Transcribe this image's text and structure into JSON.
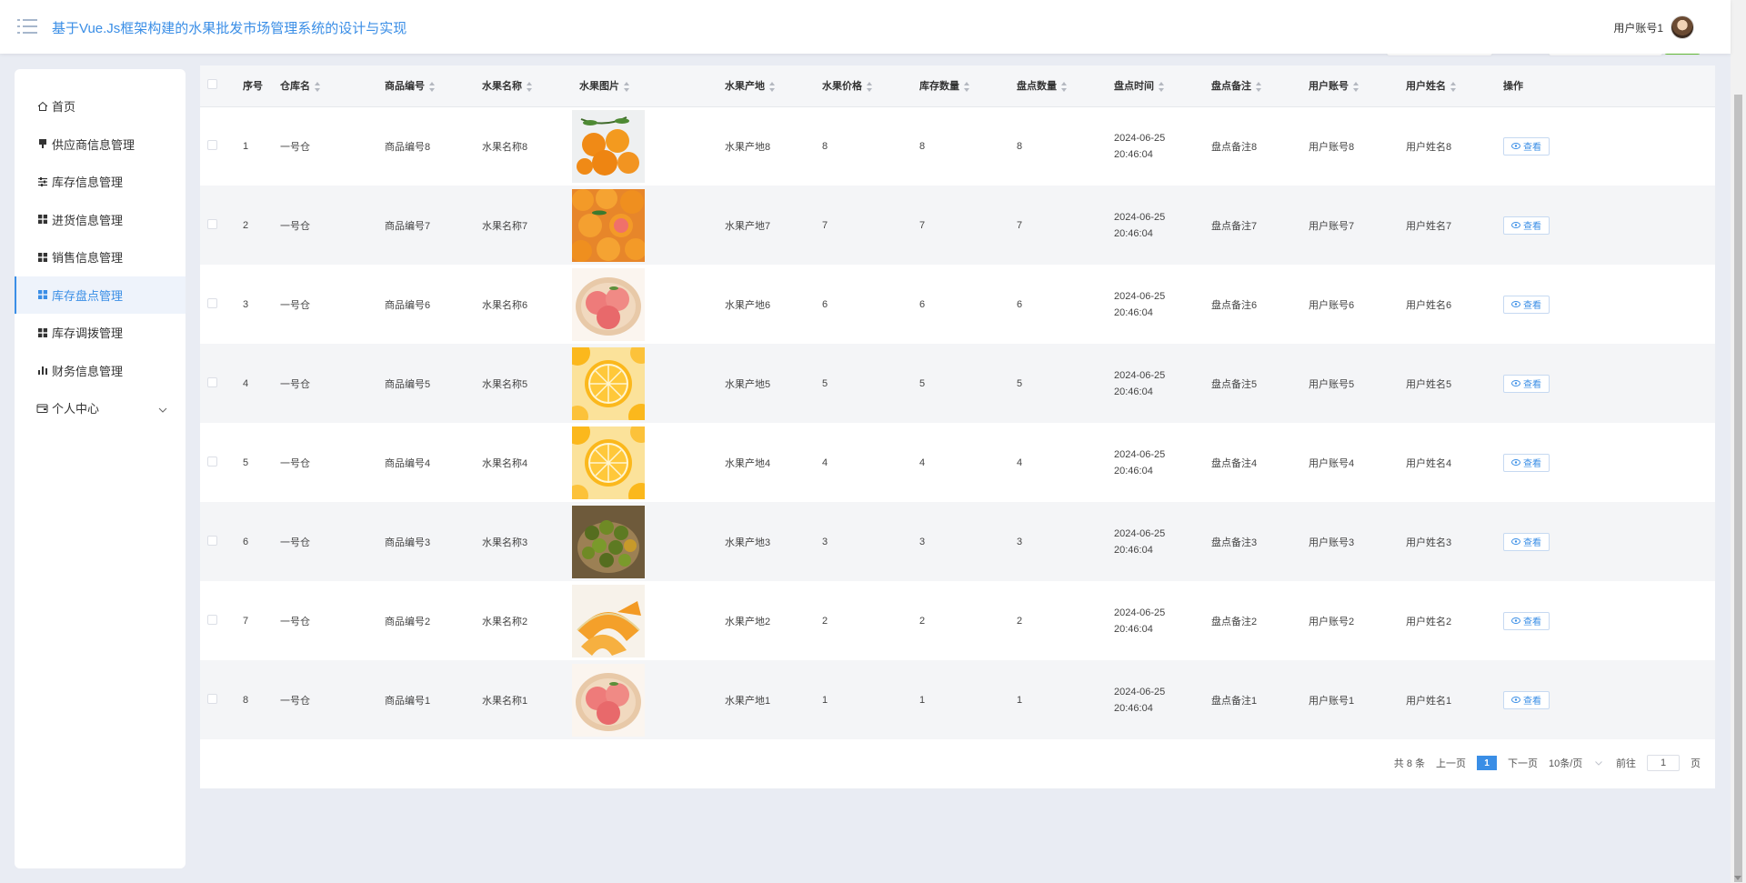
{
  "header": {
    "title": "基于Vue.Js框架构建的水果批发市场管理系统的设计与实现",
    "user_name": "用户账号1"
  },
  "sidebar": {
    "items": [
      {
        "label": "首页",
        "icon": "home-icon",
        "active": false
      },
      {
        "label": "供应商信息管理",
        "icon": "plug-icon",
        "active": false
      },
      {
        "label": "库存信息管理",
        "icon": "sliders-icon",
        "active": false
      },
      {
        "label": "进货信息管理",
        "icon": "grid-icon",
        "active": false
      },
      {
        "label": "销售信息管理",
        "icon": "grid-icon",
        "active": false
      },
      {
        "label": "库存盘点管理",
        "icon": "grid-icon",
        "active": true
      },
      {
        "label": "库存调拨管理",
        "icon": "grid-icon",
        "active": false
      },
      {
        "label": "财务信息管理",
        "icon": "bar-chart-icon",
        "active": false
      },
      {
        "label": "个人中心",
        "icon": "wallet-icon",
        "active": false,
        "expandable": true
      }
    ]
  },
  "table": {
    "columns": [
      "序号",
      "仓库名",
      "商品编号",
      "水果名称",
      "水果图片",
      "水果产地",
      "水果价格",
      "库存数量",
      "盘点数量",
      "盘点时间",
      "盘点备注",
      "用户账号",
      "用户姓名",
      "操作"
    ],
    "rows": [
      {
        "index": "1",
        "warehouse": "一号仓",
        "code": "商品编号8",
        "name": "水果名称8",
        "image": "tangerines-branch",
        "origin": "水果产地8",
        "price": "8",
        "stock": "8",
        "counted": "8",
        "time": "2024-06-25 20:46:04",
        "remark": "盘点备注8",
        "account": "用户账号8",
        "username": "用户姓名8",
        "action": "查看"
      },
      {
        "index": "2",
        "warehouse": "一号仓",
        "code": "商品编号7",
        "name": "水果名称7",
        "image": "tangerines-pile",
        "origin": "水果产地7",
        "price": "7",
        "stock": "7",
        "counted": "7",
        "time": "2024-06-25 20:46:04",
        "remark": "盘点备注7",
        "account": "用户账号7",
        "username": "用户姓名7",
        "action": "查看"
      },
      {
        "index": "3",
        "warehouse": "一号仓",
        "code": "商品编号6",
        "name": "水果名称6",
        "image": "peaches-plate",
        "origin": "水果产地6",
        "price": "6",
        "stock": "6",
        "counted": "6",
        "time": "2024-06-25 20:46:04",
        "remark": "盘点备注6",
        "account": "用户账号6",
        "username": "用户姓名6",
        "action": "查看"
      },
      {
        "index": "4",
        "warehouse": "一号仓",
        "code": "商品编号5",
        "name": "水果名称5",
        "image": "lemon-slices",
        "origin": "水果产地5",
        "price": "5",
        "stock": "5",
        "counted": "5",
        "time": "2024-06-25 20:46:04",
        "remark": "盘点备注5",
        "account": "用户账号5",
        "username": "用户姓名5",
        "action": "查看"
      },
      {
        "index": "5",
        "warehouse": "一号仓",
        "code": "商品编号4",
        "name": "水果名称4",
        "image": "lemon-slices",
        "origin": "水果产地4",
        "price": "4",
        "stock": "4",
        "counted": "4",
        "time": "2024-06-25 20:46:04",
        "remark": "盘点备注4",
        "account": "用户账号4",
        "username": "用户姓名4",
        "action": "查看"
      },
      {
        "index": "6",
        "warehouse": "一号仓",
        "code": "商品编号3",
        "name": "水果名称3",
        "image": "green-citrus-basket",
        "origin": "水果产地3",
        "price": "3",
        "stock": "3",
        "counted": "3",
        "time": "2024-06-25 20:46:04",
        "remark": "盘点备注3",
        "account": "用户账号3",
        "username": "用户姓名3",
        "action": "查看"
      },
      {
        "index": "7",
        "warehouse": "一号仓",
        "code": "商品编号2",
        "name": "水果名称2",
        "image": "melon-slices",
        "origin": "水果产地2",
        "price": "2",
        "stock": "2",
        "counted": "2",
        "time": "2024-06-25 20:46:04",
        "remark": "盘点备注2",
        "account": "用户账号2",
        "username": "用户姓名2",
        "action": "查看"
      },
      {
        "index": "8",
        "warehouse": "一号仓",
        "code": "商品编号1",
        "name": "水果名称1",
        "image": "peaches-plate",
        "origin": "水果产地1",
        "price": "1",
        "stock": "1",
        "counted": "1",
        "time": "2024-06-25 20:46:04",
        "remark": "盘点备注1",
        "account": "用户账号1",
        "username": "用户姓名1",
        "action": "查看"
      }
    ]
  },
  "pagination": {
    "total": "共 8 条",
    "prev": "上一页",
    "current": "1",
    "next": "下一页",
    "page_size": "10条/页",
    "goto_prefix": "前往",
    "goto_value": "1",
    "goto_suffix": "页"
  },
  "colors": {
    "accent": "#3a8ee6",
    "success": "#67c23a",
    "background": "#e9ecf3"
  }
}
